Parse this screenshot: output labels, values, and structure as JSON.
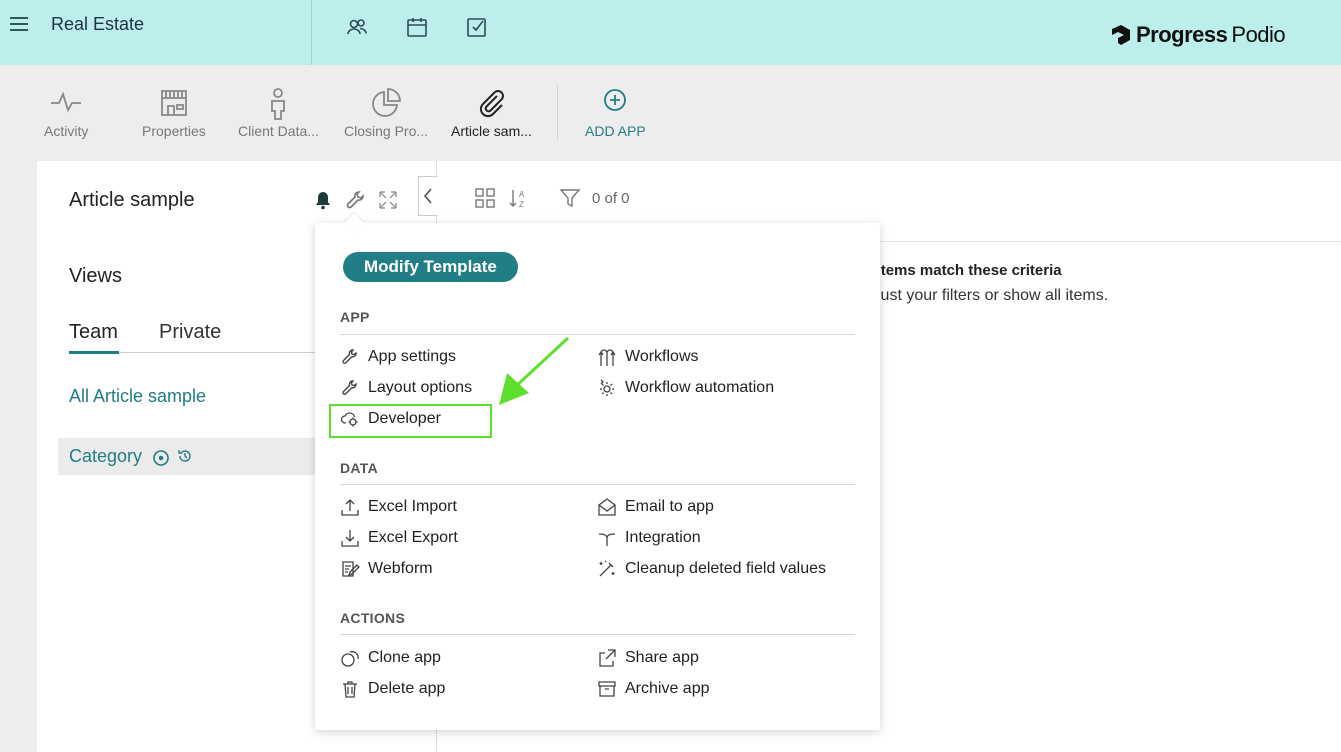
{
  "topbar": {
    "workspace_title": "Real Estate",
    "brand_bold": "Progress",
    "brand_light": "Podio",
    "icons": [
      "hamburger-icon",
      "contacts-icon",
      "calendar-icon",
      "tasks-icon"
    ]
  },
  "appbar": {
    "tabs": [
      {
        "label": "Activity",
        "icon": "activity-icon"
      },
      {
        "label": "Properties",
        "icon": "store-icon"
      },
      {
        "label": "Client Data...",
        "icon": "person-icon"
      },
      {
        "label": "Closing Pro...",
        "icon": "pie-icon"
      },
      {
        "label": "Article sam...",
        "icon": "paperclip-icon",
        "active": true
      }
    ],
    "add_app_label": "ADD APP"
  },
  "left_panel": {
    "app_title": "Article sample",
    "views_title": "Views",
    "view_tabs": [
      {
        "label": "Team",
        "active": true
      },
      {
        "label": "Private"
      }
    ],
    "all_link": "All Article sample",
    "category_label": "Category"
  },
  "main": {
    "filter_count": "0 of 0",
    "empty_title": "No items match these criteria",
    "empty_subtitle": "Please adjust your filters or show all items."
  },
  "popup": {
    "modify_button": "Modify Template",
    "sections": {
      "app": {
        "title": "APP",
        "left": [
          "App settings",
          "Layout options",
          "Developer"
        ],
        "right": [
          "Workflows",
          "Workflow automation"
        ]
      },
      "data": {
        "title": "DATA",
        "left": [
          "Excel Import",
          "Excel Export",
          "Webform"
        ],
        "right": [
          "Email to app",
          "Integration",
          "Cleanup deleted field values"
        ]
      },
      "actions": {
        "title": "ACTIONS",
        "left": [
          "Clone app",
          "Delete app"
        ],
        "right": [
          "Share app",
          "Archive app"
        ]
      }
    },
    "highlight_color": "#5de02d"
  },
  "colors": {
    "topbar_bg": "#bcefeb",
    "accent": "#217d86",
    "arrow": "#5de02d"
  }
}
